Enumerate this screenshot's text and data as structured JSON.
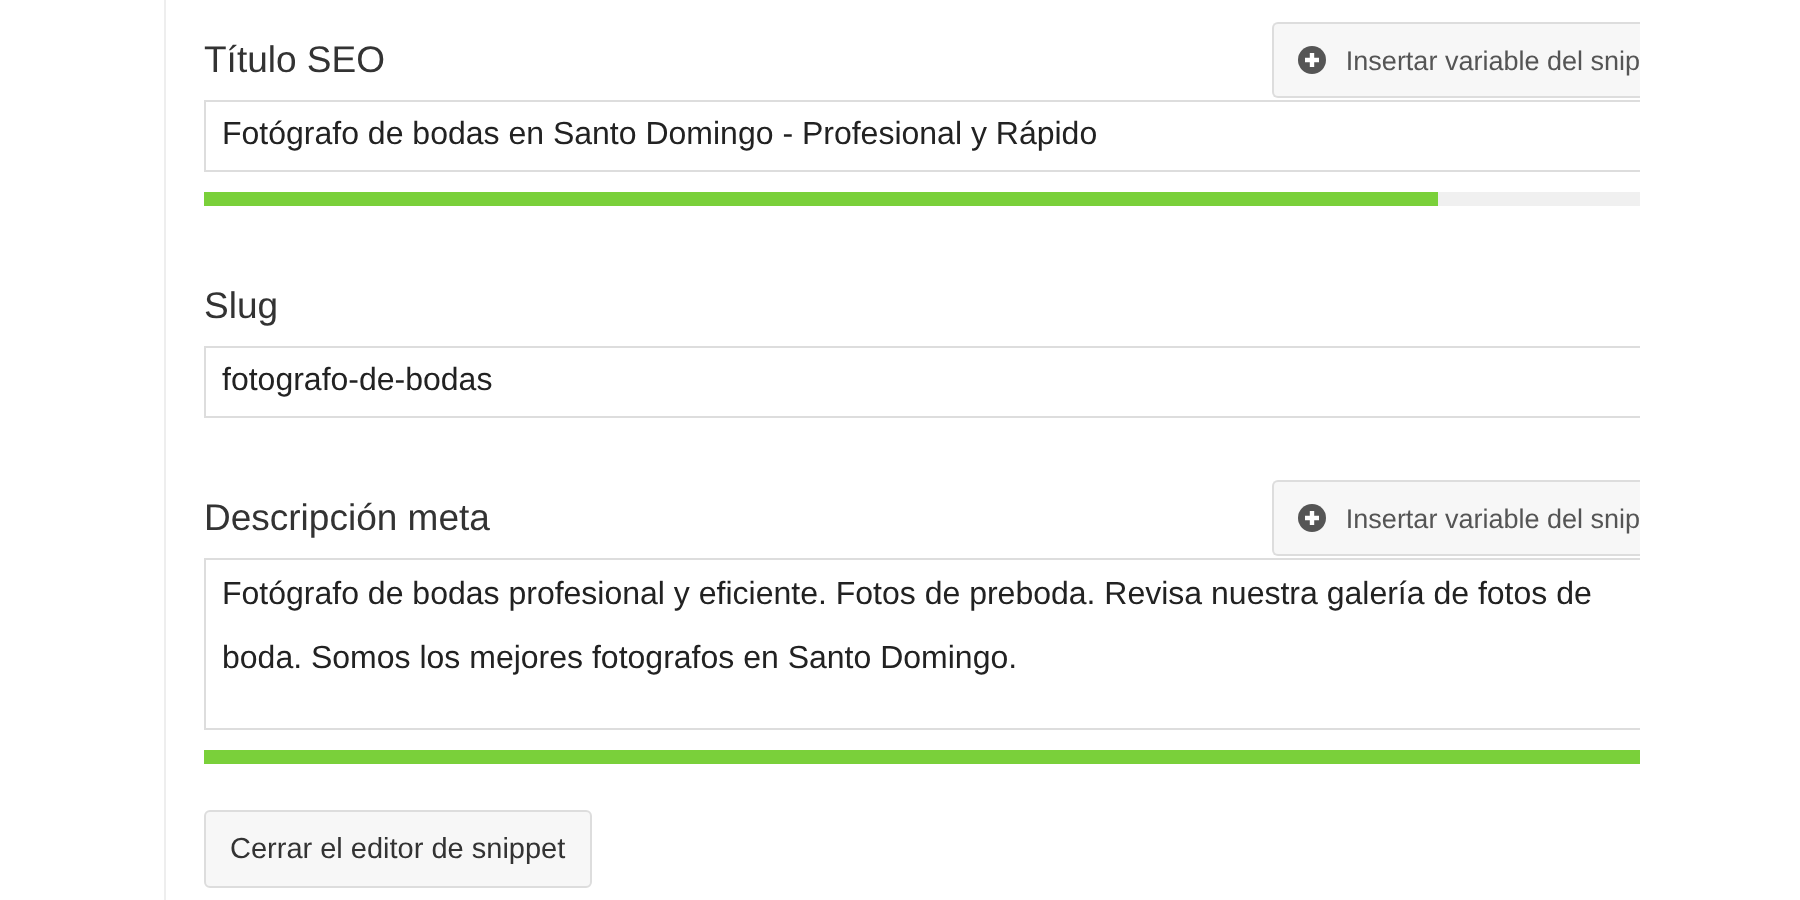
{
  "sections": [
    {
      "kind": "text",
      "label": "Título SEO",
      "button": "Insertar variable del snip",
      "value": "Fotógrafo de bodas en Santo Domingo - Profesional y Rápido",
      "level": 0.86
    },
    {
      "kind": "text",
      "label": "Slug",
      "value": "fotografo-de-bodas"
    },
    {
      "kind": "area",
      "label": "Descripción meta",
      "button": "Insertar variable del snip",
      "value": "Fotógrafo de bodas profesional y eficiente. Fotos de preboda. Revisa nuestra galería de fotos de boda. Somos los mejores fotografos en Santo Domingo.",
      "level": 1
    }
  ],
  "close_button": "Cerrar el editor de snippet"
}
